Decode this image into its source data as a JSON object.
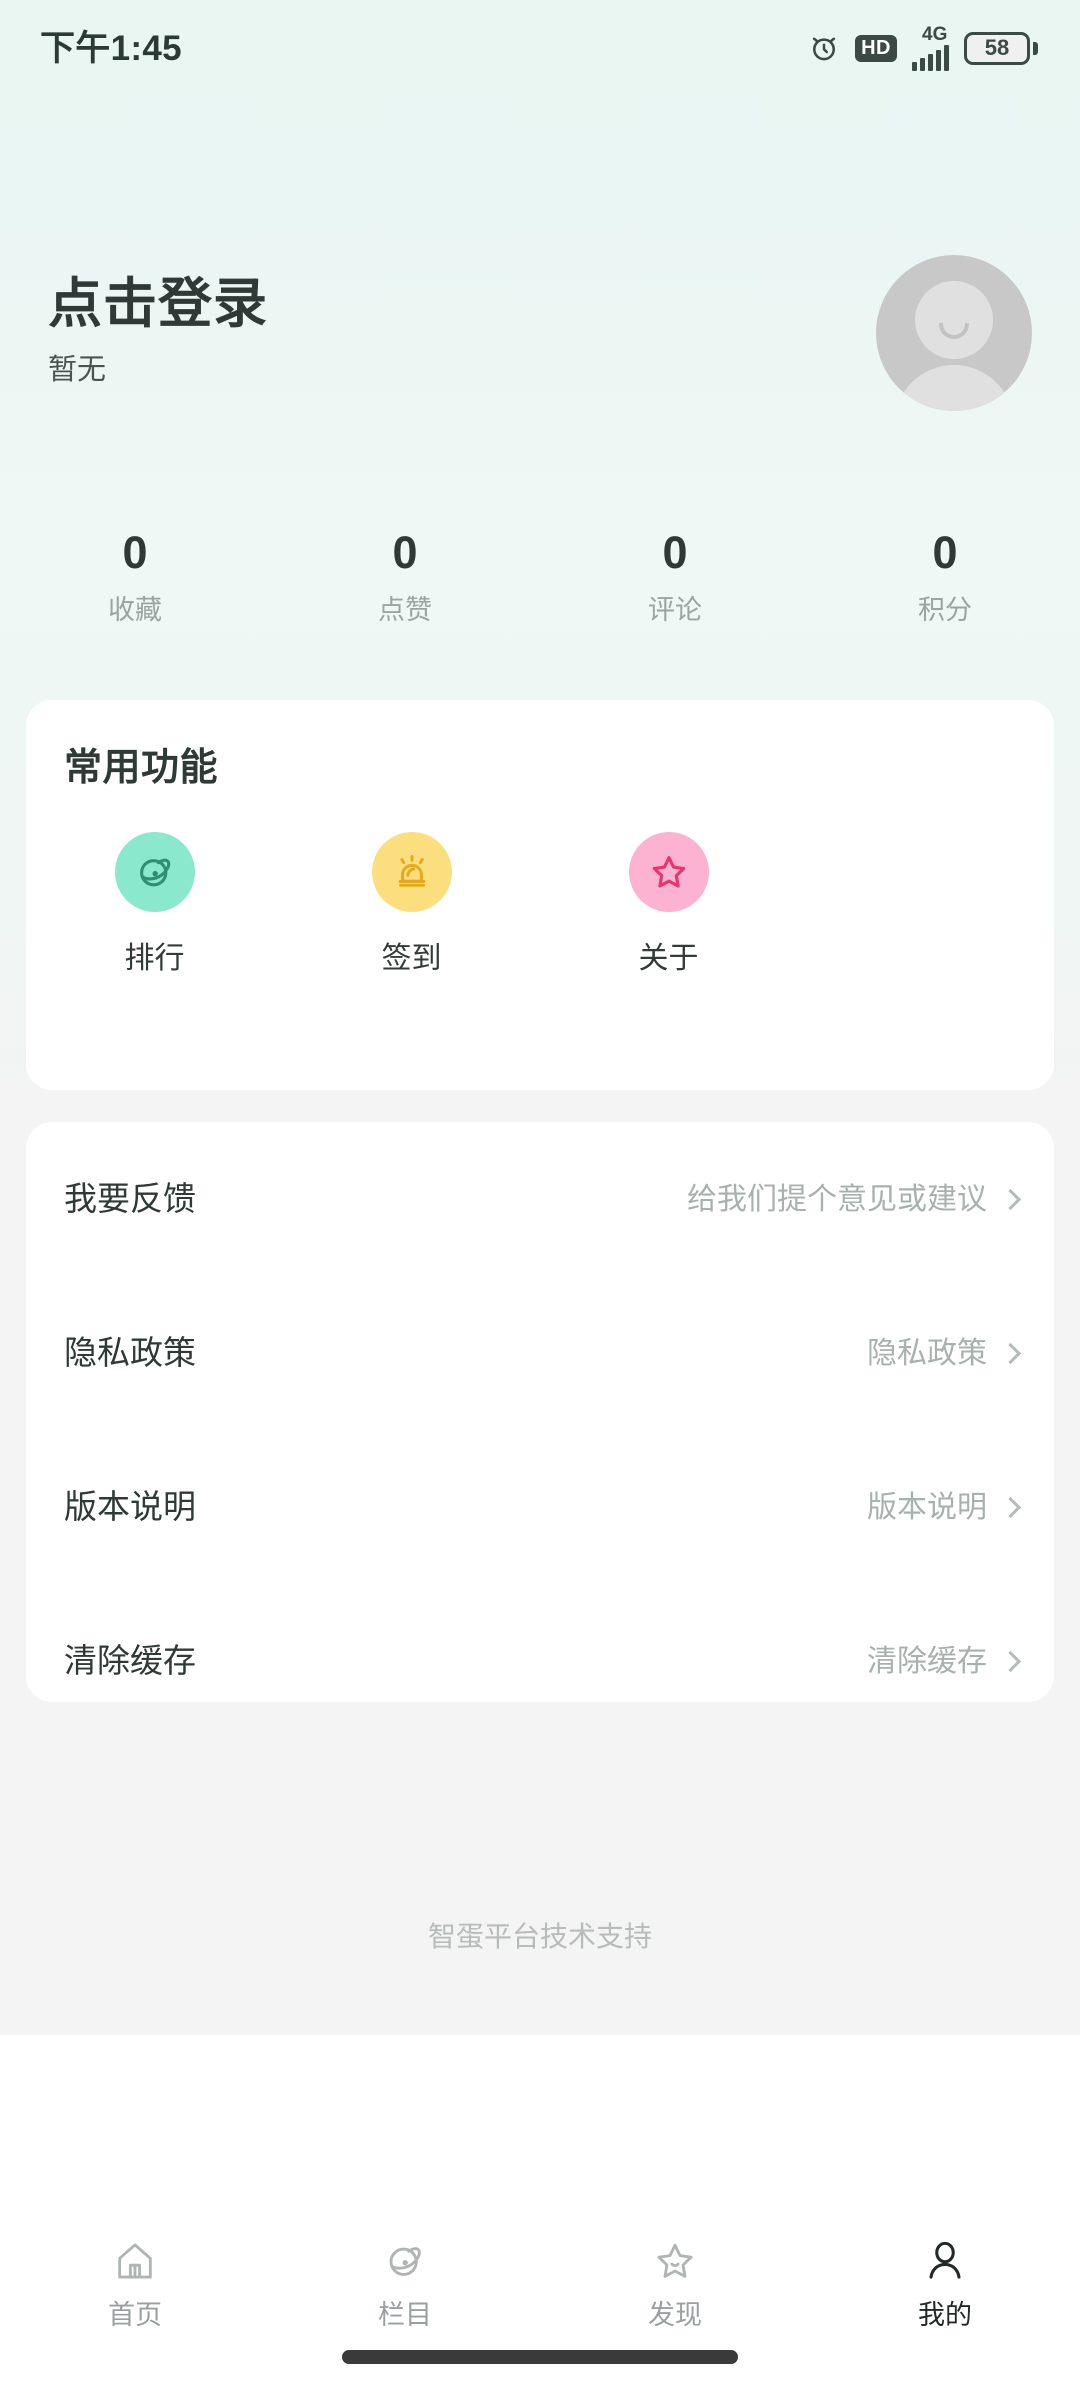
{
  "status_bar": {
    "time": "下午1:45",
    "alarm_icon": "alarm-clock-icon",
    "hd_label": "HD",
    "network_label": "4G",
    "battery_level": "58"
  },
  "profile": {
    "name": "点击登录",
    "subtitle": "暂无",
    "avatar_icon": "default-avatar-icon"
  },
  "stats": [
    {
      "value": "0",
      "label": "收藏"
    },
    {
      "value": "0",
      "label": "点赞"
    },
    {
      "value": "0",
      "label": "评论"
    },
    {
      "value": "0",
      "label": "积分"
    }
  ],
  "functions_card": {
    "title": "常用功能",
    "items": [
      {
        "label": "排行",
        "icon": "planet-icon",
        "bg": "#8ae8cd",
        "fg": "#2f8f73"
      },
      {
        "label": "签到",
        "icon": "siren-icon",
        "bg": "#fbdf7e",
        "fg": "#e8a81d"
      },
      {
        "label": "关于",
        "icon": "star-icon",
        "bg": "#fbb3d1",
        "fg": "#e8356d"
      }
    ]
  },
  "settings_card": {
    "rows": [
      {
        "label": "我要反馈",
        "value": "给我们提个意见或建议",
        "chevron": "chevron-right-icon"
      },
      {
        "label": "隐私政策",
        "value": "隐私政策",
        "chevron": "chevron-right-icon"
      },
      {
        "label": "版本说明",
        "value": "版本说明",
        "chevron": "chevron-right-icon"
      },
      {
        "label": "清除缓存",
        "value": "清除缓存",
        "chevron": "chevron-right-icon"
      }
    ]
  },
  "footer": {
    "credit": "智蛋平台技术支持"
  },
  "bottom_nav": {
    "items": [
      {
        "label": "首页",
        "icon": "home-icon",
        "active": false
      },
      {
        "label": "栏目",
        "icon": "planet-icon",
        "active": false
      },
      {
        "label": "发现",
        "icon": "star-icon",
        "active": false
      },
      {
        "label": "我的",
        "icon": "person-icon",
        "active": true
      }
    ]
  }
}
